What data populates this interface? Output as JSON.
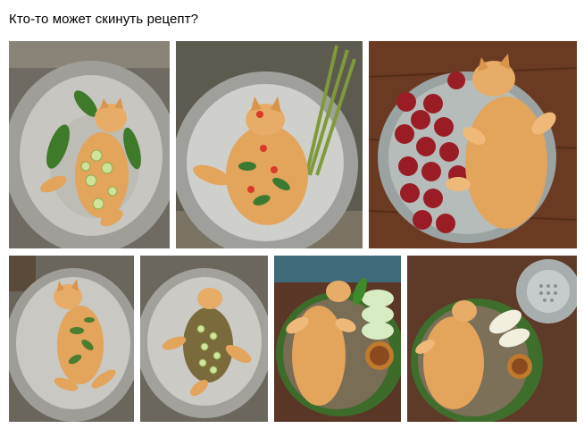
{
  "post": {
    "text": "Кто-то может скинуть рецепт?"
  },
  "gallery": {
    "photo_count": 7,
    "subjects": [
      "ginger cat lying in a wok with lime slices and greens",
      "ginger cat in a metal bowl with chili, lemongrass and herbs",
      "ginger cat on a platter with red plums",
      "ginger cat in a wok covered with greens",
      "ginger cat in a wok with sliced cucumbers and herbs",
      "ginger cat on a tray with vegetables and sauce bowl",
      "ginger cat on a tray next to a steamer with greens"
    ]
  },
  "colors": {
    "background": "#ffffff",
    "text": "#000000",
    "cat_fur": "#e3a45c",
    "metal": "#b9b9b4"
  }
}
